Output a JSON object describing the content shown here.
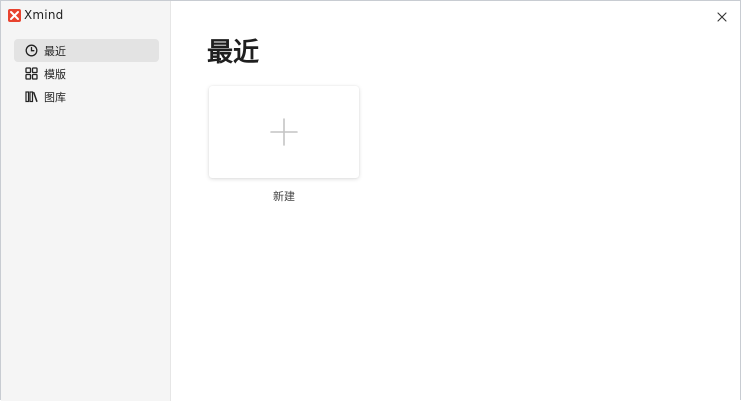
{
  "app": {
    "name": "Xmind",
    "brand_color": "#e8432f"
  },
  "sidebar": {
    "items": [
      {
        "label": "最近",
        "icon": "clock-icon",
        "active": true
      },
      {
        "label": "模版",
        "icon": "grid-icon",
        "active": false
      },
      {
        "label": "图库",
        "icon": "library-icon",
        "active": false
      }
    ]
  },
  "main": {
    "title": "最近",
    "new_card": {
      "label": "新建",
      "icon": "plus-icon"
    }
  },
  "window": {
    "close_icon": "close-icon"
  }
}
